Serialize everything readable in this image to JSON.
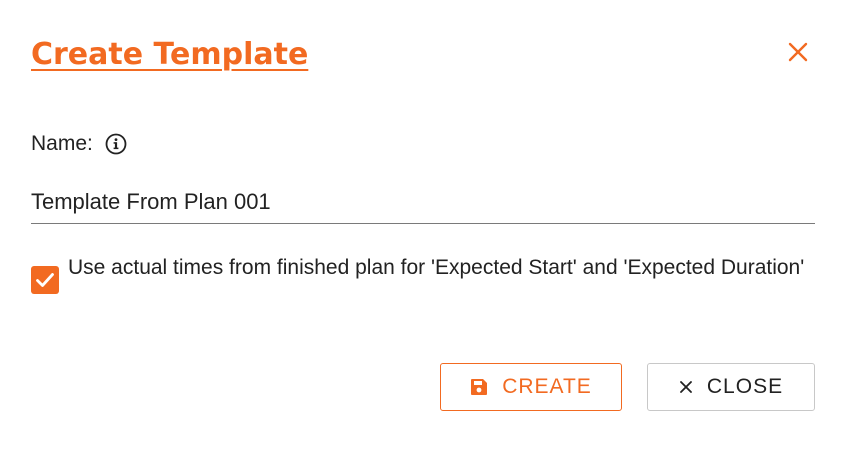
{
  "dialog": {
    "title": "Create Template",
    "name_label": "Name:",
    "name_value": "Template From Plan 001",
    "checkbox_checked": true,
    "checkbox_label": "Use actual times from finished plan for 'Expected Start' and 'Expected Duration'",
    "create_label": "CREATE",
    "close_label": "CLOSE"
  },
  "icons": {
    "close": "close-icon",
    "info": "info-icon",
    "check": "check-icon",
    "save": "save-icon",
    "close_small": "close-icon"
  },
  "colors": {
    "accent": "#f26a21",
    "text": "#222222",
    "underline": "#7a7a7a",
    "close_border": "#c8c8c8"
  }
}
